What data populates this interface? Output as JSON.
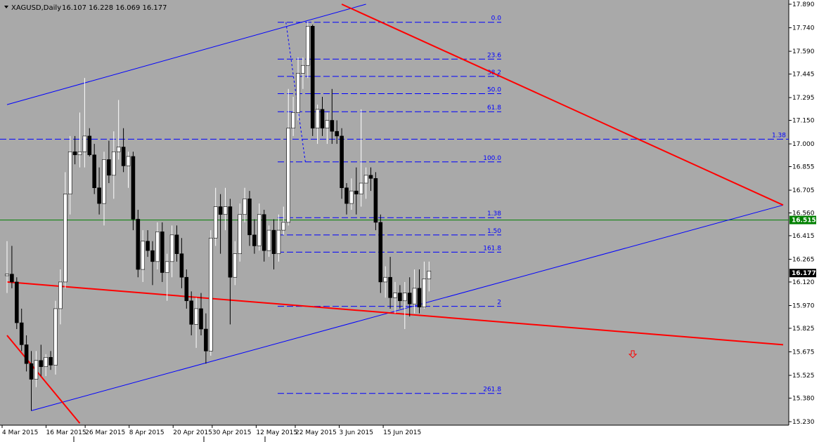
{
  "header": {
    "symbol": "XAGUSD,Daily",
    "ohlc": "16.107 16.228 16.069 16.177"
  },
  "colors": {
    "background": "#a9a9a9",
    "bull_candle": "#ffffff",
    "bear_candle": "#000000",
    "channel": "#0000ff",
    "trendline": "#ff0000",
    "level_line": "#008000",
    "fib": "#0000ff",
    "axis_panel": "#ffffff"
  },
  "chart_data": {
    "type": "candlestick",
    "x_tick_labels": [
      "4 Mar 2015",
      "16 Mar 2015",
      "26 Mar 2015",
      "8 Apr 2015",
      "20 Apr 2015",
      "30 Apr 2015",
      "12 May 2015",
      "22 May 2015",
      "3 Jun 2015",
      "15 Jun 2015"
    ],
    "y_tick_labels": [
      "17.890",
      "17.740",
      "17.590",
      "17.445",
      "17.295",
      "17.150",
      "17.000",
      "16.855",
      "16.705",
      "16.560",
      "16.415",
      "16.265",
      "16.120",
      "15.970",
      "15.825",
      "15.675",
      "15.525",
      "15.380",
      "15.230"
    ],
    "ylim": [
      15.22,
      17.9
    ],
    "candles": [
      {
        "o": 16.16,
        "h": 16.38,
        "l": 16.05,
        "c": 16.17
      },
      {
        "o": 16.17,
        "h": 16.35,
        "l": 16.08,
        "c": 16.12
      },
      {
        "o": 16.12,
        "h": 16.15,
        "l": 15.82,
        "c": 15.86
      },
      {
        "o": 15.86,
        "h": 15.95,
        "l": 15.68,
        "c": 15.72
      },
      {
        "o": 15.72,
        "h": 15.78,
        "l": 15.55,
        "c": 15.6
      },
      {
        "o": 15.6,
        "h": 15.68,
        "l": 15.3,
        "c": 15.5
      },
      {
        "o": 15.5,
        "h": 15.68,
        "l": 15.45,
        "c": 15.62
      },
      {
        "o": 15.62,
        "h": 15.72,
        "l": 15.52,
        "c": 15.58
      },
      {
        "o": 15.58,
        "h": 15.66,
        "l": 15.52,
        "c": 15.64
      },
      {
        "o": 15.64,
        "h": 15.68,
        "l": 15.56,
        "c": 15.59
      },
      {
        "o": 15.59,
        "h": 16.0,
        "l": 15.53,
        "c": 15.95
      },
      {
        "o": 15.95,
        "h": 16.2,
        "l": 15.85,
        "c": 16.12
      },
      {
        "o": 16.12,
        "h": 16.82,
        "l": 16.08,
        "c": 16.68
      },
      {
        "o": 16.68,
        "h": 17.05,
        "l": 16.55,
        "c": 16.95
      },
      {
        "o": 16.95,
        "h": 17.05,
        "l": 16.87,
        "c": 16.93
      },
      {
        "o": 16.93,
        "h": 17.2,
        "l": 16.85,
        "c": 16.95
      },
      {
        "o": 16.95,
        "h": 17.42,
        "l": 16.85,
        "c": 17.05
      },
      {
        "o": 17.05,
        "h": 17.1,
        "l": 16.92,
        "c": 16.93
      },
      {
        "o": 16.93,
        "h": 17.0,
        "l": 16.68,
        "c": 16.72
      },
      {
        "o": 16.72,
        "h": 16.85,
        "l": 16.55,
        "c": 16.62
      },
      {
        "o": 16.62,
        "h": 16.95,
        "l": 16.48,
        "c": 16.9
      },
      {
        "o": 16.9,
        "h": 17.02,
        "l": 16.75,
        "c": 16.8
      },
      {
        "o": 16.8,
        "h": 17.08,
        "l": 16.65,
        "c": 16.95
      },
      {
        "o": 16.95,
        "h": 17.28,
        "l": 16.9,
        "c": 16.98
      },
      {
        "o": 16.98,
        "h": 17.1,
        "l": 16.82,
        "c": 16.86
      },
      {
        "o": 16.86,
        "h": 16.95,
        "l": 16.72,
        "c": 16.92
      },
      {
        "o": 16.92,
        "h": 16.95,
        "l": 16.45,
        "c": 16.52
      },
      {
        "o": 16.52,
        "h": 16.58,
        "l": 16.15,
        "c": 16.2
      },
      {
        "o": 16.2,
        "h": 16.45,
        "l": 16.12,
        "c": 16.38
      },
      {
        "o": 16.38,
        "h": 16.45,
        "l": 16.28,
        "c": 16.32
      },
      {
        "o": 16.32,
        "h": 16.38,
        "l": 16.1,
        "c": 16.25
      },
      {
        "o": 16.25,
        "h": 16.5,
        "l": 16.2,
        "c": 16.44
      },
      {
        "o": 16.44,
        "h": 16.5,
        "l": 16.12,
        "c": 16.18
      },
      {
        "o": 16.18,
        "h": 16.3,
        "l": 16.0,
        "c": 16.25
      },
      {
        "o": 16.25,
        "h": 16.48,
        "l": 16.15,
        "c": 16.42
      },
      {
        "o": 16.42,
        "h": 16.48,
        "l": 16.25,
        "c": 16.3
      },
      {
        "o": 16.3,
        "h": 16.4,
        "l": 16.08,
        "c": 16.15
      },
      {
        "o": 16.15,
        "h": 16.2,
        "l": 15.95,
        "c": 16.0
      },
      {
        "o": 16.0,
        "h": 16.06,
        "l": 15.78,
        "c": 15.85
      },
      {
        "o": 15.85,
        "h": 16.02,
        "l": 15.7,
        "c": 15.95
      },
      {
        "o": 15.95,
        "h": 16.05,
        "l": 15.78,
        "c": 15.82
      },
      {
        "o": 15.82,
        "h": 15.92,
        "l": 15.6,
        "c": 15.68
      },
      {
        "o": 15.68,
        "h": 16.45,
        "l": 15.65,
        "c": 16.4
      },
      {
        "o": 16.4,
        "h": 16.72,
        "l": 16.35,
        "c": 16.6
      },
      {
        "o": 16.6,
        "h": 16.68,
        "l": 16.3,
        "c": 16.55
      },
      {
        "o": 16.55,
        "h": 16.72,
        "l": 16.45,
        "c": 16.6
      },
      {
        "o": 16.6,
        "h": 16.65,
        "l": 15.85,
        "c": 16.15
      },
      {
        "o": 16.15,
        "h": 16.38,
        "l": 16.1,
        "c": 16.3
      },
      {
        "o": 16.3,
        "h": 16.62,
        "l": 16.25,
        "c": 16.55
      },
      {
        "o": 16.55,
        "h": 16.72,
        "l": 16.5,
        "c": 16.65
      },
      {
        "o": 16.65,
        "h": 16.7,
        "l": 16.35,
        "c": 16.42
      },
      {
        "o": 16.42,
        "h": 16.52,
        "l": 16.3,
        "c": 16.35
      },
      {
        "o": 16.35,
        "h": 16.62,
        "l": 16.32,
        "c": 16.55
      },
      {
        "o": 16.55,
        "h": 16.58,
        "l": 16.25,
        "c": 16.32
      },
      {
        "o": 16.32,
        "h": 16.48,
        "l": 16.28,
        "c": 16.45
      },
      {
        "o": 16.45,
        "h": 16.52,
        "l": 16.2,
        "c": 16.3
      },
      {
        "o": 16.3,
        "h": 16.55,
        "l": 16.25,
        "c": 16.45
      },
      {
        "o": 16.45,
        "h": 16.6,
        "l": 16.42,
        "c": 16.5
      },
      {
        "o": 16.5,
        "h": 17.35,
        "l": 16.48,
        "c": 17.1
      },
      {
        "o": 17.1,
        "h": 17.3,
        "l": 17.05,
        "c": 17.2
      },
      {
        "o": 17.2,
        "h": 17.55,
        "l": 17.15,
        "c": 17.45
      },
      {
        "o": 17.45,
        "h": 17.55,
        "l": 17.35,
        "c": 17.5
      },
      {
        "o": 17.5,
        "h": 17.78,
        "l": 17.42,
        "c": 17.75
      },
      {
        "o": 17.75,
        "h": 17.76,
        "l": 17.05,
        "c": 17.1
      },
      {
        "o": 17.1,
        "h": 17.25,
        "l": 17.0,
        "c": 17.22
      },
      {
        "o": 17.22,
        "h": 17.3,
        "l": 17.05,
        "c": 17.1
      },
      {
        "o": 17.1,
        "h": 17.2,
        "l": 17.0,
        "c": 17.15
      },
      {
        "o": 17.15,
        "h": 17.35,
        "l": 17.0,
        "c": 17.08
      },
      {
        "o": 17.08,
        "h": 17.15,
        "l": 17.0,
        "c": 17.05
      },
      {
        "o": 17.05,
        "h": 17.1,
        "l": 16.65,
        "c": 16.72
      },
      {
        "o": 16.72,
        "h": 16.75,
        "l": 16.55,
        "c": 16.62
      },
      {
        "o": 16.62,
        "h": 16.78,
        "l": 16.58,
        "c": 16.7
      },
      {
        "o": 16.7,
        "h": 16.85,
        "l": 16.55,
        "c": 16.68
      },
      {
        "o": 16.68,
        "h": 17.22,
        "l": 16.6,
        "c": 16.75
      },
      {
        "o": 16.75,
        "h": 16.85,
        "l": 16.65,
        "c": 16.8
      },
      {
        "o": 16.8,
        "h": 16.85,
        "l": 16.7,
        "c": 16.78
      },
      {
        "o": 16.78,
        "h": 16.82,
        "l": 16.45,
        "c": 16.5
      },
      {
        "o": 16.5,
        "h": 16.55,
        "l": 16.05,
        "c": 16.12
      },
      {
        "o": 16.12,
        "h": 16.22,
        "l": 16.02,
        "c": 16.15
      },
      {
        "o": 16.15,
        "h": 16.28,
        "l": 15.95,
        "c": 16.02
      },
      {
        "o": 16.02,
        "h": 16.12,
        "l": 15.92,
        "c": 16.05
      },
      {
        "o": 16.05,
        "h": 16.1,
        "l": 15.95,
        "c": 16.0
      },
      {
        "o": 16.0,
        "h": 16.12,
        "l": 15.82,
        "c": 16.05
      },
      {
        "o": 16.05,
        "h": 16.15,
        "l": 15.9,
        "c": 15.98
      },
      {
        "o": 15.98,
        "h": 16.2,
        "l": 15.92,
        "c": 16.08
      },
      {
        "o": 16.08,
        "h": 16.2,
        "l": 15.92,
        "c": 15.96
      },
      {
        "o": 15.96,
        "h": 16.25,
        "l": 15.95,
        "c": 16.14
      },
      {
        "o": 16.14,
        "h": 16.25,
        "l": 16.06,
        "c": 16.19
      }
    ],
    "fibonacci": {
      "levels": [
        "0.0",
        "23.6",
        "38.2",
        "50.0",
        "61.8",
        "100.0",
        "1.38",
        "1.50",
        "161.8",
        "2",
        "261.8"
      ],
      "prices": [
        17.775,
        17.54,
        17.43,
        17.32,
        17.205,
        16.885,
        16.53,
        16.42,
        16.31,
        15.965,
        15.41
      ]
    },
    "horizontal_lines": [
      {
        "label": "1.38",
        "price": 17.03,
        "style": "dashed"
      },
      {
        "label": "16.515",
        "price": 16.515,
        "style": "solid"
      }
    ],
    "current_price": "16.177",
    "trendlines": {
      "channel_upper": {
        "x_index": [
          0,
          74
        ],
        "price": [
          17.25,
          17.89
        ]
      },
      "channel_lower": {
        "x_index": [
          5,
          160
        ],
        "price": [
          15.3,
          16.61
        ]
      },
      "red_upper": {
        "x_index": [
          69,
          160
        ],
        "price": [
          17.89,
          16.61
        ]
      },
      "red_lower_left": {
        "x_index": [
          0,
          15
        ],
        "price": [
          15.78,
          15.22
        ]
      },
      "red_lower": {
        "x_index": [
          0,
          160
        ],
        "price": [
          16.12,
          15.72
        ]
      }
    },
    "arrow_marker": {
      "x_index": 129,
      "price": 15.66,
      "direction": "down"
    }
  }
}
